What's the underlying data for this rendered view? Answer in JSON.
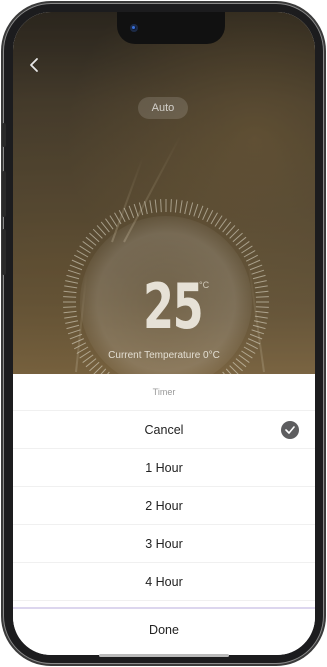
{
  "header": {
    "mode_label": "Auto"
  },
  "thermostat": {
    "temperature": "25",
    "unit": "°C",
    "current_temperature_label": "Current Temperature 0°C"
  },
  "timer_sheet": {
    "title": "Timer",
    "options": [
      "Cancel",
      "1 Hour",
      "2 Hour",
      "3 Hour",
      "4 Hour"
    ],
    "selected_option": "Cancel",
    "done_label": "Done"
  },
  "icons": [
    "back-chevron-icon",
    "checkmark-icon",
    "front-camera-icon"
  ],
  "colors": {
    "check_badge": "#5d5d5f",
    "divider": "#dcd6ee"
  }
}
